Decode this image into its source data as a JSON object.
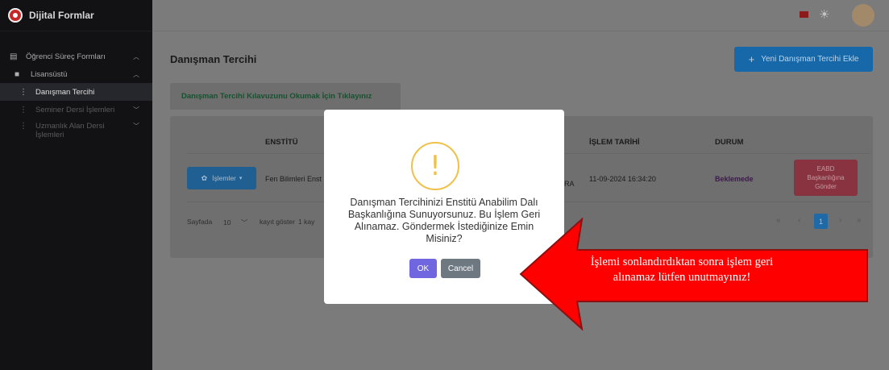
{
  "app": {
    "title": "Dijital Formlar"
  },
  "sidebar": {
    "items": [
      {
        "label": "Öğrenci Süreç Formları",
        "icon": "form-icon"
      },
      {
        "label": "Lisansüstü",
        "icon": "document-icon"
      },
      {
        "label": "Danışman Tercihi",
        "icon": "kebab-icon"
      },
      {
        "label": "Seminer Dersi İşlemleri",
        "icon": "kebab-icon"
      },
      {
        "label": "Uzmanlık Alan Dersi İşlemleri",
        "icon": "kebab-icon"
      }
    ]
  },
  "header": {
    "language_flag": "tr-flag-icon",
    "theme_icon": "sun-icon",
    "avatar": "avatar"
  },
  "page": {
    "title": "Danışman Tercihi",
    "add_button": "Yeni Danışman Tercihi Ekle",
    "guide_tab": "Danışman Tercihi Kılavuzunu Okumak İçin Tıklayınız"
  },
  "table": {
    "headers": {
      "enstitu": "ENSTİTÜ",
      "islem_tarihi": "İŞLEM TARİHİ",
      "durum": "DURUM"
    },
    "row": {
      "ops_button": "İşlemler",
      "enstitu": "Fen Bilimleri Enst",
      "partial": "RA",
      "islem_tarihi": "11-09-2024 16:34:20",
      "durum": "Beklemede",
      "action_button": "EABD\nBaşkanlığına\nGönder"
    },
    "pager": {
      "prefix": "Sayfada",
      "page_size": "10",
      "suffix": "kayıt göster",
      "info": "1 kay",
      "current_page": "1"
    }
  },
  "modal": {
    "message": "Danışman Tercihinizi Enstitü Anabilim Dalı Başkanlığına Sunuyorsunuz. Bu İşlem Geri Alınamaz. Göndermek İstediğinize Emin Misiniz?",
    "ok": "OK",
    "cancel": "Cancel"
  },
  "callout": {
    "text": "İşlemi sonlandırdıktan sonra işlem geri alınamaz lütfen unutmayınız!",
    "color": "#ff0000"
  },
  "colors": {
    "sidebar_bg": "#121214",
    "primary": "#1768a8",
    "ok_button": "#7066e0",
    "warning": "#f0c14a"
  }
}
